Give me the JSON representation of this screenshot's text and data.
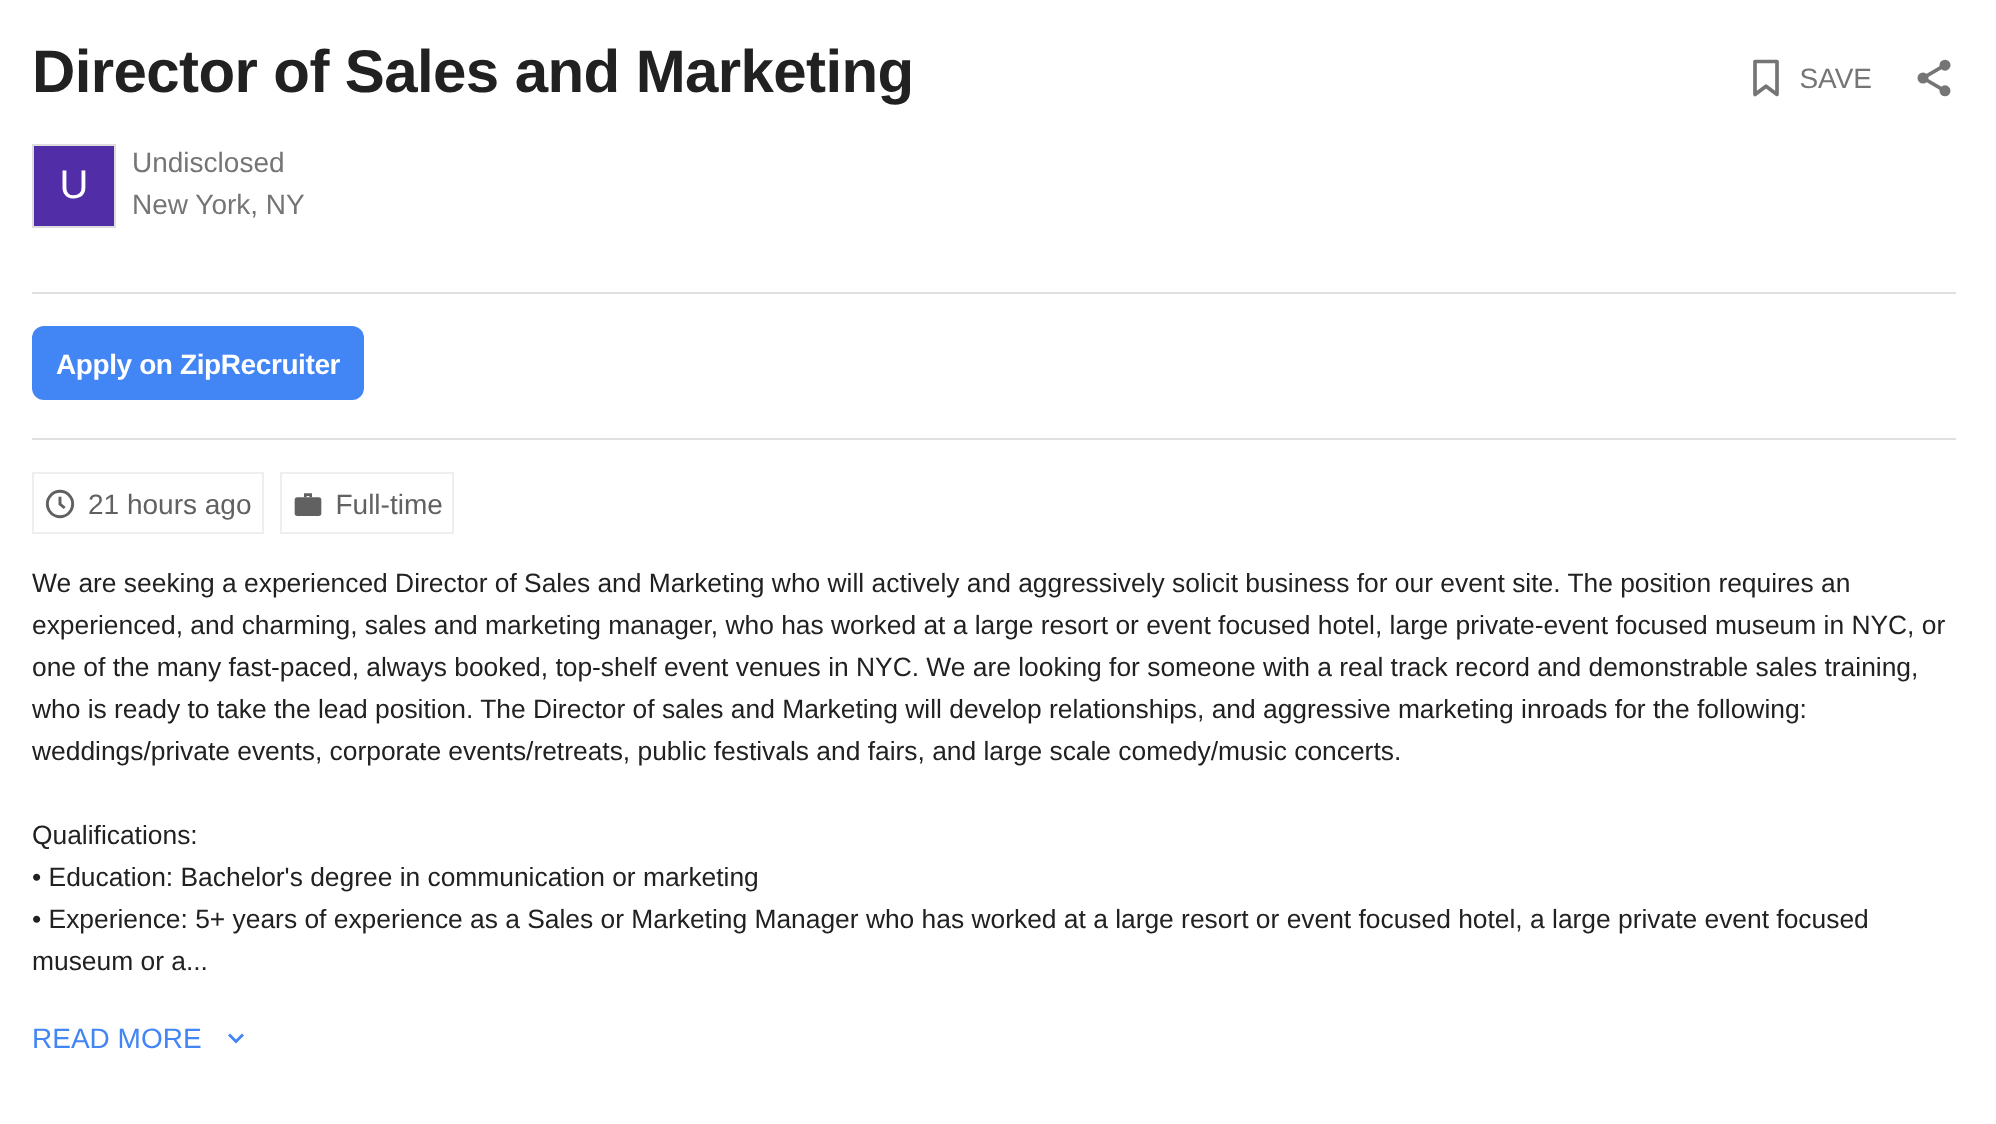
{
  "job": {
    "title": "Director of Sales and Marketing",
    "company_initial": "U",
    "company": "Undisclosed",
    "location": "New York, NY"
  },
  "actions": {
    "save": "SAVE",
    "saved": false
  },
  "apply_button": "Apply on ZipRecruiter",
  "tags": [
    {
      "kind": "time",
      "label": "21 hours ago"
    },
    {
      "kind": "type",
      "label": "Full-time"
    }
  ],
  "description": [
    "We are seeking a experienced Director of Sales and Marketing who will actively and aggressively solicit business for our event site. The position requires an experienced, and charming, sales and marketing manager, who has worked at a large resort or event focused hotel, large private-event focused museum in NYC, or one of the many fast-paced, always booked, top-shelf event venues in NYC. We are looking for someone with a real track record and demonstrable sales training, who is ready to take the lead position. The Director of sales and Marketing will develop relationships, and aggressive marketing inroads for the following: weddings/private events, corporate events/retreats, public festivals and fairs, and large scale comedy/music concerts."
  ],
  "qualifications": {
    "heading": "Qualifications:",
    "items": [
      "• Education: Bachelor's degree in communication or marketing",
      "• Experience: 5+ years of experience as a Sales or Marketing Manager who has worked at a large resort or event focused hotel, a large private event focused museum or a..."
    ]
  },
  "read_more": "READ MORE"
}
